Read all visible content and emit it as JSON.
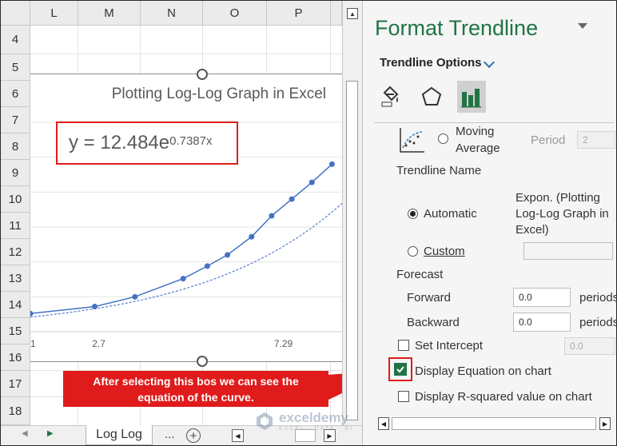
{
  "sheet": {
    "columns": [
      "L",
      "M",
      "N",
      "O",
      "P"
    ],
    "rows": [
      "4",
      "5",
      "6",
      "7",
      "8",
      "9",
      "10",
      "11",
      "12",
      "13",
      "14",
      "15",
      "16",
      "17",
      "18"
    ],
    "tab_label": "Log Log",
    "tab_more": "...",
    "tab_add": "+"
  },
  "chart": {
    "title": "Plotting Log-Log Graph in Excel",
    "equation": {
      "base": "y = 12.484e",
      "exponent": "0.7387x"
    }
  },
  "chart_data": {
    "type": "scatter",
    "title": "Plotting Log-Log Graph in Excel",
    "xlabel": "",
    "ylabel": "",
    "x_tick_labels": [
      "1",
      "2.7",
      "7.29"
    ],
    "series": [
      {
        "x": [
          1.0,
          2.6,
          3.6,
          4.8,
          5.4,
          5.9,
          6.5,
          7.0,
          7.5,
          8.0,
          8.5
        ],
        "y": [
          0.13,
          0.18,
          0.25,
          0.38,
          0.47,
          0.55,
          0.68,
          0.83,
          0.95,
          1.07,
          1.2
        ]
      }
    ],
    "trendline": {
      "type": "exponential",
      "a": 12.484,
      "b": 0.7387
    },
    "grid": true
  },
  "annotation": "After selecting this bos we can see the equation of the curve.",
  "watermark": {
    "name": "exceldemy",
    "tagline": "EXCEL · DATA · BI"
  },
  "pane": {
    "title": "Format Trendline",
    "section": "Trendline Options",
    "moving_average_line1": "Moving",
    "moving_average_line2": "Average",
    "period_label": "Period",
    "period_value": "2",
    "trendline_name_label": "Trendline Name",
    "automatic_label": "Automatic",
    "automatic_name_line1": "Expon. (Plotting",
    "automatic_name_line2": "Log-Log Graph in",
    "automatic_name_line3": "Excel)",
    "custom_label": "Custom",
    "forecast_label": "Forecast",
    "forward_label": "Forward",
    "forward_value": "0.0",
    "backward_label": "Backward",
    "backward_value": "0.0",
    "periods_label": "periods",
    "set_intercept_label": "Set Intercept",
    "intercept_value": "0.0",
    "display_equation_label": "Display Equation on chart",
    "display_r2_label": "Display R-squared value on chart"
  },
  "colors": {
    "accent": "#217346",
    "highlight": "#e01b1b",
    "series": "#4472c4"
  }
}
